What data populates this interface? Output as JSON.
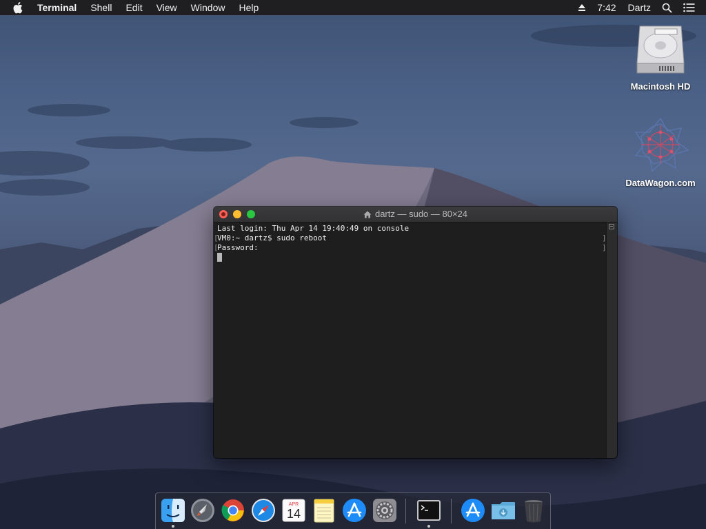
{
  "menubar": {
    "app_name": "Terminal",
    "menus": [
      "Shell",
      "Edit",
      "View",
      "Window",
      "Help"
    ],
    "time": "7:42",
    "user": "Dartz"
  },
  "desktop": {
    "icons": [
      {
        "label": "Macintosh HD",
        "icon": "hard-drive-icon"
      },
      {
        "label": "DataWagon.com",
        "icon": "datawagon-logo-icon"
      }
    ]
  },
  "terminal": {
    "title": "dartz — sudo — 80×24",
    "lines": [
      "Last login: Thu Apr 14 19:40:49 on console",
      "VM0:~ dartz$ sudo reboot",
      "Password:"
    ]
  },
  "dock": {
    "calendar": {
      "month": "APR",
      "day": "14"
    },
    "items": [
      "finder-icon",
      "launchpad-icon",
      "chrome-icon",
      "safari-icon",
      "calendar-icon",
      "notes-icon",
      "app-store-icon",
      "system-preferences-icon",
      "terminal-icon",
      "app-store-folder-icon",
      "downloads-folder-icon",
      "trash-icon"
    ]
  },
  "colors": {
    "menubar_bg": "#1f1f22",
    "terminal_bg": "#1e1e1e",
    "close": "#ff5f57",
    "minimize": "#febc2e",
    "zoom": "#28c840"
  }
}
